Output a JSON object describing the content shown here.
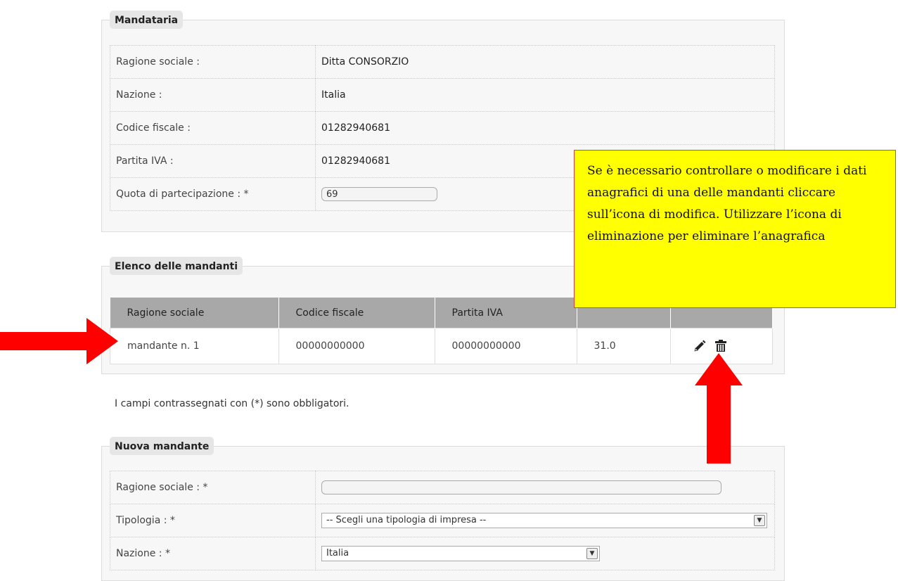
{
  "mandataria": {
    "legend": "Mandataria",
    "rows": [
      {
        "label": "Ragione sociale :",
        "value": "Ditta CONSORZIO"
      },
      {
        "label": "Nazione :",
        "value": "Italia"
      },
      {
        "label": "Codice fiscale :",
        "value": "01282940681"
      },
      {
        "label": "Partita IVA :",
        "value": "01282940681"
      }
    ],
    "quota_label": "Quota di partecipazione : *",
    "quota_value": "69"
  },
  "mandanti": {
    "legend": "Elenco delle mandanti",
    "headers": [
      "Ragione sociale",
      "Codice fiscale",
      "Partita IVA",
      "",
      ""
    ],
    "rows": [
      {
        "ragione_sociale": "mandante n. 1",
        "codice_fiscale": "00000000000",
        "partita_iva": "00000000000",
        "quota": "31.0"
      }
    ]
  },
  "note": "I campi contrassegnati con (*) sono obbligatori.",
  "nuova": {
    "legend": "Nuova mandante",
    "ragione_label": "Ragione sociale : *",
    "ragione_value": "",
    "tipologia_label": "Tipologia : *",
    "tipologia_value": "-- Scegli una tipologia di impresa --",
    "nazione_label": "Nazione : *",
    "nazione_value": "Italia"
  },
  "callout": {
    "text": "Se è necessario controllare o modificare i dati anagrafici di una delle mandanti cliccare sull’icona di modifica. Utilizzare l’icona di eliminazione per eliminare l’anagrafica"
  },
  "icons": {
    "edit": "pencil-icon",
    "delete": "trash-icon",
    "arrow_right": "arrow-right-icon",
    "arrow_up": "arrow-up-icon"
  },
  "colors": {
    "callout_bg": "#ffff00",
    "arrow": "#ff0000",
    "header_bg": "#a8a8a8"
  }
}
